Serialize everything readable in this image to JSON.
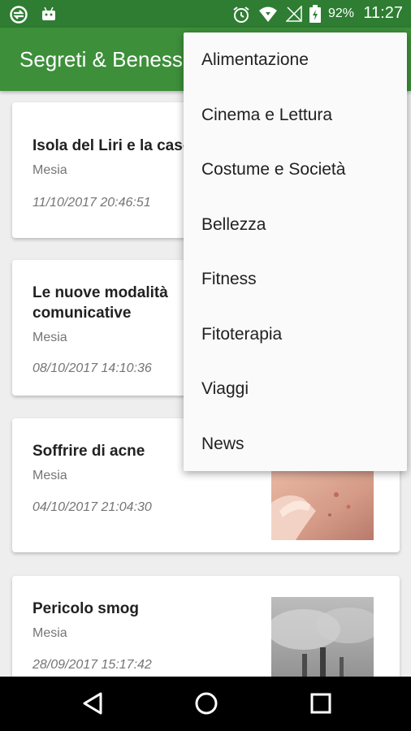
{
  "status_bar": {
    "battery_percent": "92%",
    "time": "11:27",
    "icons": [
      "sync-app-icon",
      "android-icon",
      "alarm-icon",
      "wifi-icon",
      "no-signal-icon",
      "battery-charging-icon"
    ]
  },
  "app_bar": {
    "title": "Segreti & Benessere"
  },
  "articles": [
    {
      "title": "Isola del Liri e la cascata",
      "author": "Mesia",
      "date": "11/10/2017 20:46:51"
    },
    {
      "title": "Le nuove modalità comunicative",
      "author": "Mesia",
      "date": "08/10/2017 14:10:36"
    },
    {
      "title": "Soffrire di acne",
      "author": "Mesia",
      "date": "04/10/2017 21:04:30"
    },
    {
      "title": "Pericolo smog",
      "author": "Mesia",
      "date": "28/09/2017 15:17:42"
    }
  ],
  "menu": {
    "items": [
      "Alimentazione",
      "Cinema e Lettura",
      "Costume e Società",
      "Bellezza",
      "Fitness",
      "Fitoterapia",
      "Viaggi",
      "News"
    ]
  },
  "nav_bar": {
    "buttons": [
      "back-icon",
      "home-icon",
      "recents-icon"
    ]
  },
  "colors": {
    "status_bar": "#2e7d32",
    "app_bar": "#3d8f3a",
    "background": "#eeeeee",
    "menu_background": "#fafafa"
  }
}
